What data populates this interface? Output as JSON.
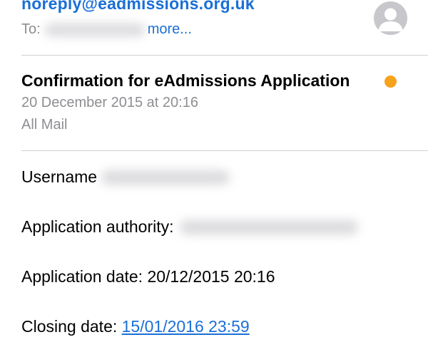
{
  "header": {
    "sender": "noreply@eadmissions.org.uk",
    "to_label": "To:",
    "more_label": "more..."
  },
  "message": {
    "subject": "Confirmation for eAdmissions Application",
    "date": "20 December 2015 at 20:16",
    "mailbox": "All Mail"
  },
  "body": {
    "username_label": "Username",
    "authority_label": "Application authority:",
    "application_date": "Application date: 20/12/2015 20:16",
    "closing_label": "Closing date: ",
    "closing_value": "15/01/2016 23:59"
  },
  "colors": {
    "link": "#1a6fd6",
    "unread": "#f7a21b",
    "secondary_text": "#8e8e93"
  },
  "icons": {
    "avatar": "person-silhouette-icon",
    "unread": "unread-dot-icon"
  }
}
